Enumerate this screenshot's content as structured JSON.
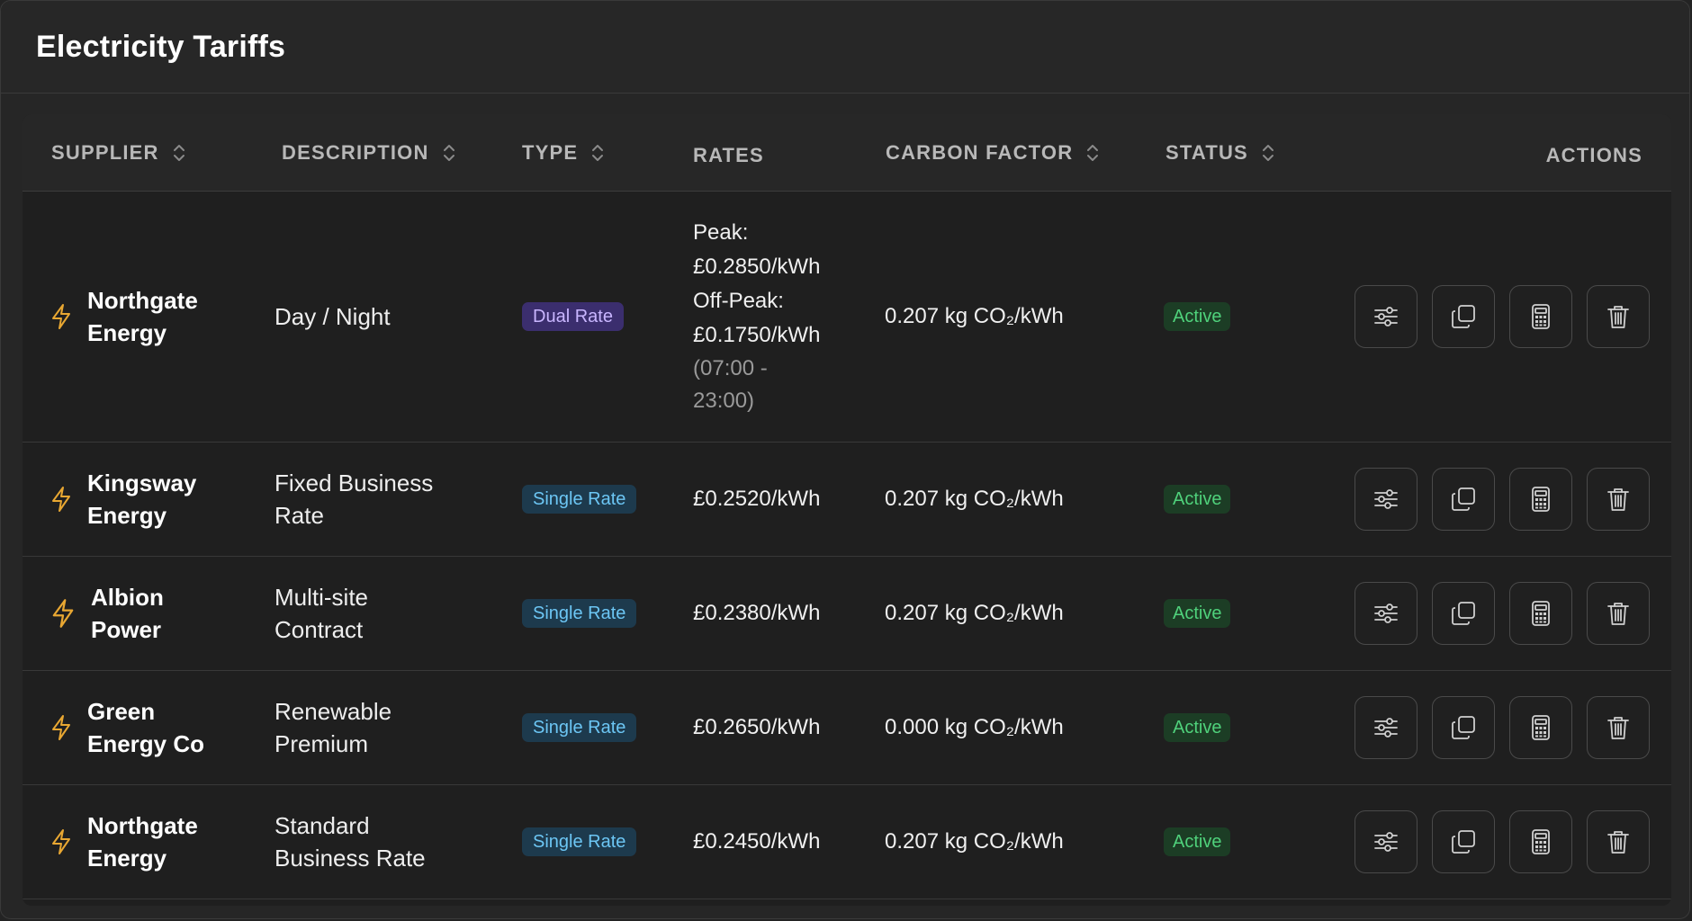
{
  "header": {
    "title": "Electricity Tariffs"
  },
  "table": {
    "columns": {
      "supplier": "SUPPLIER",
      "description": "DESCRIPTION",
      "type": "TYPE",
      "rates": "RATES",
      "carbon": "CARBON FACTOR",
      "status": "STATUS",
      "actions": "ACTIONS"
    },
    "rows": [
      {
        "supplier_line1": "Northgate",
        "supplier_line2": "Energy",
        "description_line1": "Day / Night",
        "description_line2": "",
        "type": "Dual Rate",
        "rates_peak_label": "Peak:",
        "rates_peak_value": "£0.2850/kWh",
        "rates_offpeak_label": "Off-Peak:",
        "rates_offpeak_value": "£0.1750/kWh",
        "rates_time_line1": "(07:00 -",
        "rates_time_line2": "23:00)",
        "carbon": "0.207 kg CO₂/kWh",
        "status": "Active"
      },
      {
        "supplier_line1": "Kingsway",
        "supplier_line2": "Energy",
        "description_line1": "Fixed Business",
        "description_line2": "Rate",
        "type": "Single Rate",
        "rate": "£0.2520/kWh",
        "carbon": "0.207 kg CO₂/kWh",
        "status": "Active"
      },
      {
        "supplier_line1": "Albion",
        "supplier_line2": "Power",
        "description_line1": "Multi-site",
        "description_line2": "Contract",
        "type": "Single Rate",
        "rate": "£0.2380/kWh",
        "carbon": "0.207 kg CO₂/kWh",
        "status": "Active"
      },
      {
        "supplier_line1": "Green",
        "supplier_line2": "Energy Co",
        "description_line1": "Renewable",
        "description_line2": "Premium",
        "type": "Single Rate",
        "rate": "£0.2650/kWh",
        "carbon": "0.000 kg CO₂/kWh",
        "status": "Active"
      },
      {
        "supplier_line1": "Northgate",
        "supplier_line2": "Energy",
        "description_line1": "Standard",
        "description_line2": "Business Rate",
        "type": "Single Rate",
        "rate": "£0.2450/kWh",
        "carbon": "0.207 kg CO₂/kWh",
        "status": "Active"
      }
    ],
    "row_actions": [
      "sliders-icon",
      "copy-icon",
      "calculator-icon",
      "trash-icon"
    ]
  },
  "colors": {
    "bolt": "#e8a732",
    "dual_rate_badge": "#3b2e6e",
    "single_rate_badge": "#1d3a4d",
    "active_badge": "#1c3d25",
    "active_text": "#4fd17b"
  }
}
